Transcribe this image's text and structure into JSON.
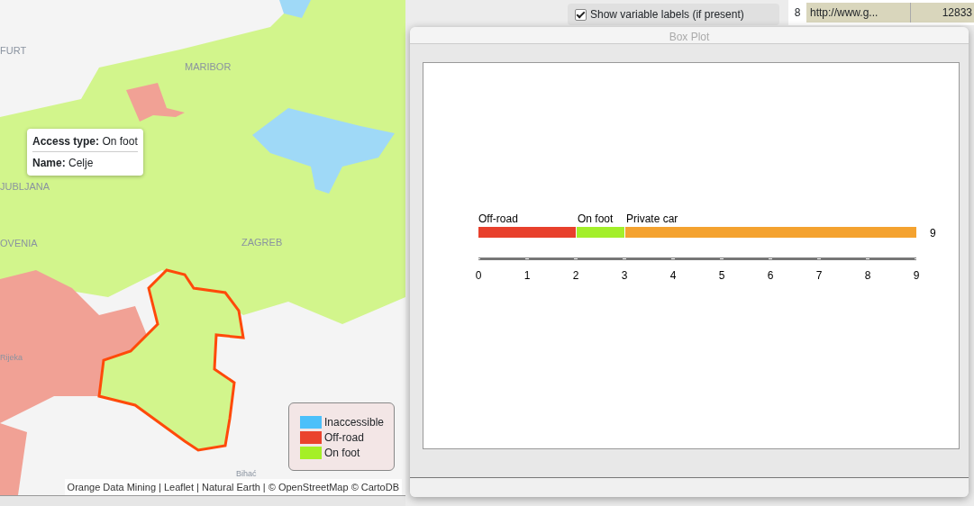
{
  "map": {
    "place_labels": [
      "FURT",
      "MARIBOR",
      "JUBLJANA",
      "OVENIA",
      "ZAGREB",
      "Rijeka",
      "Bihać"
    ],
    "tooltip": [
      {
        "key": "Access type:",
        "value": "On foot"
      },
      {
        "key": "Name:",
        "value": "Celje"
      }
    ],
    "legend": [
      {
        "label": "Inaccessible",
        "color": "#4cc0fa"
      },
      {
        "label": "Off-road",
        "color": "#ea432d"
      },
      {
        "label": "On foot",
        "color": "#a5ef27"
      }
    ],
    "attribution": "Orange Data Mining | Leaflet | Natural Earth | © OpenStreetMap © CartoDB"
  },
  "background": {
    "checkbox": {
      "label": "Show variable labels (if present)",
      "checked": true
    },
    "row_number": "8",
    "url_cell": "http://www.g...",
    "number_cell": "12833"
  },
  "box_plot": {
    "title": "Box Plot",
    "chart_data": {
      "type": "bar",
      "orientation": "horizontal",
      "stacked": true,
      "xlim": [
        0,
        9
      ],
      "series": [
        {
          "name": "Off-road",
          "color": "#e8402c",
          "values": [
            2
          ]
        },
        {
          "name": "On foot",
          "color": "#a3ef2a",
          "values": [
            1
          ]
        },
        {
          "name": "Private car",
          "color": "#f4a22f",
          "values": [
            6
          ]
        }
      ],
      "annotations": [
        {
          "text": "9"
        }
      ],
      "xticks": [
        0,
        1,
        2,
        3,
        4,
        5,
        6,
        7,
        8,
        9
      ]
    }
  }
}
